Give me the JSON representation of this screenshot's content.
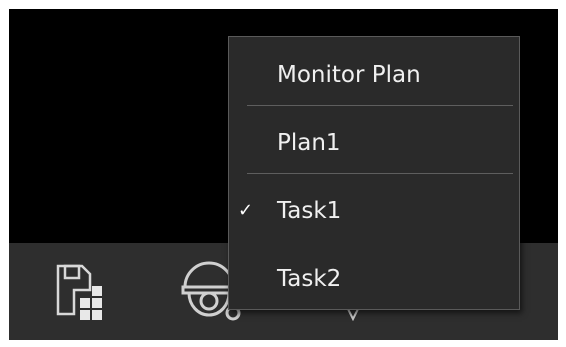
{
  "menu": {
    "header": "Monitor Plan",
    "items": [
      {
        "label": "Plan1",
        "checked": false
      },
      {
        "label": "Task1",
        "checked": true
      },
      {
        "label": "Task2",
        "checked": false
      }
    ],
    "check_mark": "✓"
  },
  "toolbar": {
    "icons": [
      "save-layout-icon",
      "dome-camera-icon",
      "partial-icon"
    ]
  },
  "colors": {
    "background": "#000000",
    "toolbar": "#2e2e2e",
    "menu": "#2a2a2a",
    "menu_border": "#5a5a5a",
    "text": "#f0f0f0"
  }
}
